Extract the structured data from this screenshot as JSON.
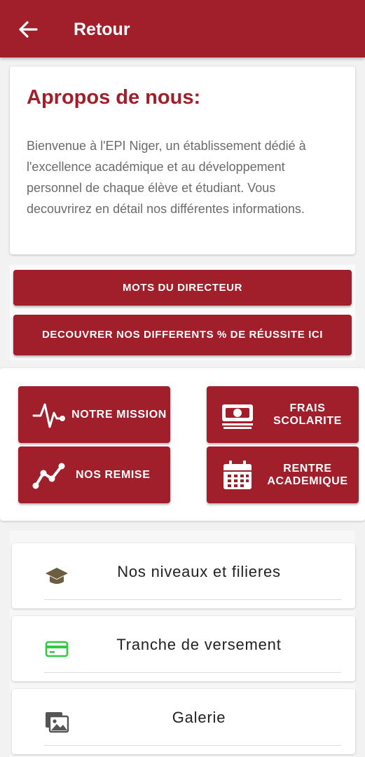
{
  "appbar": {
    "back_icon": "arrow-left-icon",
    "title": "Retour",
    "color": "#a11f2b"
  },
  "about": {
    "title": "Apropos de nous:",
    "text": "Bienvenue à l'EPI Niger, un établissement dédié à l'excellence académique et au développement personnel de chaque élève et étudiant. Vous decouvrirez en détail nos différentes informations."
  },
  "buttons": {
    "director": "MOTS DU DIRECTEUR",
    "success": "DECOUVRER NOS DIFFERENTS % DE RÉUSSITE ICI"
  },
  "tiles": [
    {
      "label": "NOTRE MISSION",
      "icon": "heartbeat-icon"
    },
    {
      "label": "FRAIS SCOLARITE",
      "icon": "money-icon"
    },
    {
      "label": "NOS REMISE",
      "icon": "trend-line-icon"
    },
    {
      "label": "RENTRE ACADEMIQUE",
      "icon": "calendar-icon"
    }
  ],
  "list": [
    {
      "label": "Nos niveaux et filieres",
      "icon": "graduation-cap-icon",
      "icon_color": "#6b5d3f"
    },
    {
      "label": "Tranche de versement",
      "icon": "credit-card-icon",
      "icon_color": "#2ecc40"
    },
    {
      "label": "Galerie",
      "icon": "gallery-icon",
      "icon_color": "#555555"
    }
  ]
}
